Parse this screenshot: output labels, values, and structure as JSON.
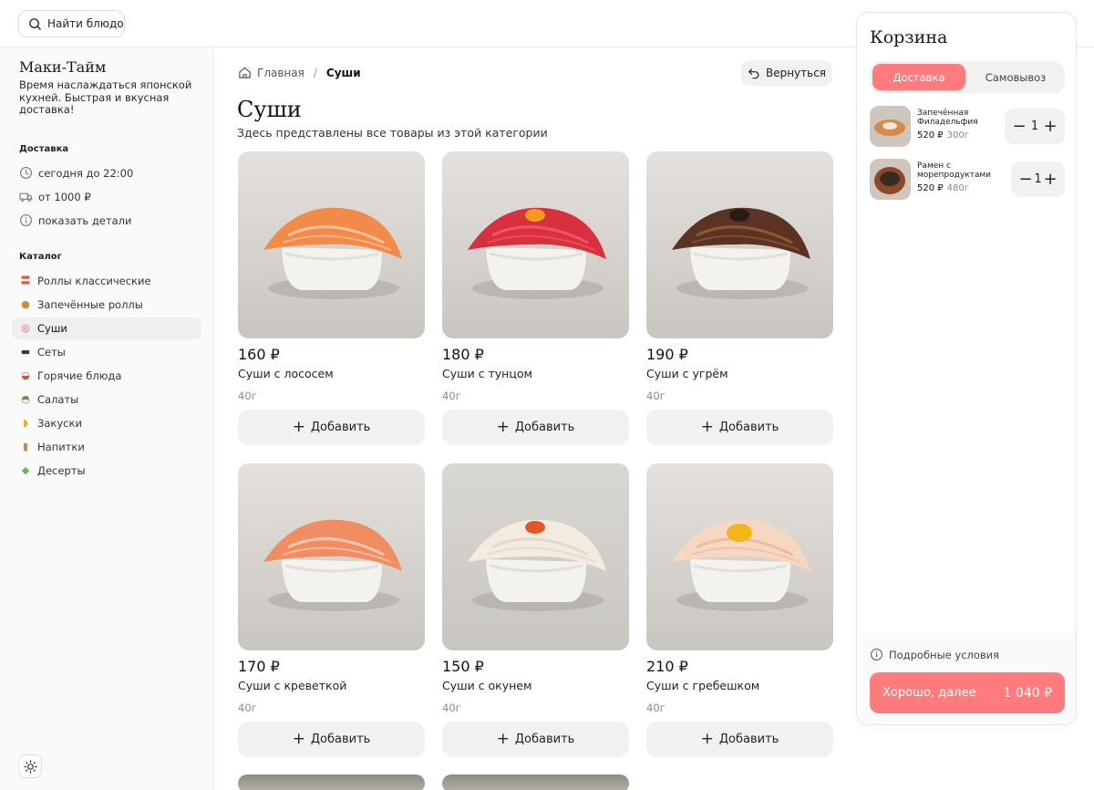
{
  "topbar": {
    "search_label": "Найти блюдо"
  },
  "sidebar": {
    "brand": "Маки-Тайм",
    "tagline": "Время наслаждаться японской кухней. Быстрая и вкусная доставка!",
    "delivery_title": "Доставка",
    "delivery_info": [
      {
        "icon": "clock-icon",
        "text": "сегодня до 22:00"
      },
      {
        "icon": "truck-icon",
        "text": "от 1000 ₽"
      },
      {
        "icon": "info-icon",
        "text": "показать детали"
      }
    ],
    "catalog_title": "Каталог",
    "categories": [
      {
        "label": "Роллы классические",
        "icon": "rolls-icon",
        "glyph": "〓",
        "color": "#e8573f",
        "active": false
      },
      {
        "label": "Запечённые роллы",
        "icon": "baked-rolls-icon",
        "glyph": "●",
        "color": "#d9863b",
        "active": false
      },
      {
        "label": "Суши",
        "icon": "sushi-icon",
        "glyph": "◎",
        "color": "#e05b5b",
        "active": true
      },
      {
        "label": "Сеты",
        "icon": "sets-icon",
        "glyph": "▬",
        "color": "#3c3c3c",
        "active": false
      },
      {
        "label": "Горячие блюда",
        "icon": "hot-bowl-icon",
        "glyph": "◒",
        "color": "#d94a3a",
        "active": false
      },
      {
        "label": "Салаты",
        "icon": "salad-icon",
        "glyph": "◓",
        "color": "#5b9b3e",
        "active": false
      },
      {
        "label": "Закуски",
        "icon": "snack-icon",
        "glyph": "◗",
        "color": "#e7a93b",
        "active": false
      },
      {
        "label": "Напитки",
        "icon": "drink-icon",
        "glyph": "▮",
        "color": "#c98b55",
        "active": false
      },
      {
        "label": "Десерты",
        "icon": "dessert-icon",
        "glyph": "◆",
        "color": "#6fb35a",
        "active": false
      }
    ]
  },
  "breadcrumb": {
    "home": "Главная",
    "separator": "/",
    "current": "Суши"
  },
  "back_label": "Вернуться",
  "page": {
    "title": "Суши",
    "subtitle": "Здесь представлены все товары из этой категории"
  },
  "products": [
    {
      "price": "160 ₽",
      "name": "Суши с лососем",
      "weight": "40г",
      "topping": "#f28a4a",
      "stripe": "#ffd2b0",
      "accent": ""
    },
    {
      "price": "180 ₽",
      "name": "Суши с тунцом",
      "weight": "40г",
      "topping": "#d9303f",
      "stripe": "#f06070",
      "accent": "#f39a25"
    },
    {
      "price": "190 ₽",
      "name": "Суши с угрём",
      "weight": "40г",
      "topping": "#5a3324",
      "stripe": "#a0602e",
      "accent": "#2a1a14"
    },
    {
      "price": "170 ₽",
      "name": "Суши с креветкой",
      "weight": "40г",
      "topping": "#f08d63",
      "stripe": "#ffd7c0",
      "accent": ""
    },
    {
      "price": "150 ₽",
      "name": "Суши с окунем",
      "weight": "40г",
      "topping": "#f3ebe0",
      "stripe": "#e3d2c2",
      "accent": "#e2562a"
    },
    {
      "price": "210 ₽",
      "name": "Суши с гребешком",
      "weight": "40г",
      "topping": "#f5d7c2",
      "stripe": "#eab79b",
      "accent": "#f4b41a"
    }
  ],
  "add_label": "Добавить",
  "cart": {
    "title": "Корзина",
    "modes": [
      "Доставка",
      "Самовывоз"
    ],
    "active_mode": 0,
    "items": [
      {
        "name": "Запечённая Филадельфия",
        "price": "520 ₽",
        "weight": "300г",
        "qty": "1",
        "minus": "−",
        "plus": "+",
        "tone": "#d58a4f"
      },
      {
        "name": "Рамен с морепродуктами",
        "price": "520 ₽",
        "weight": "480г",
        "qty": "1",
        "minus": "−",
        "plus": "+",
        "tone": "#8a4a2a"
      }
    ],
    "terms_label": "Подробные условия",
    "checkout_label": "Хорошо, далее",
    "total": "1 040 ₽"
  },
  "colors": {
    "accent": "#ff7b7d",
    "soft_bg": "#f1f1f1"
  }
}
